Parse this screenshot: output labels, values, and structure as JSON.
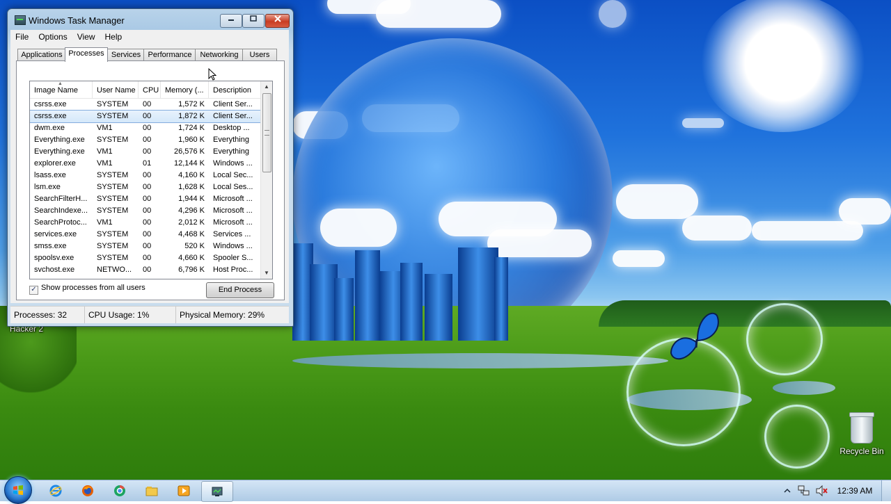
{
  "window": {
    "title": "Windows Task Manager",
    "controls": {
      "minimize": "minimize",
      "maximize": "maximize",
      "close": "close"
    }
  },
  "menu": [
    "File",
    "Options",
    "View",
    "Help"
  ],
  "tabs": [
    "Applications",
    "Processes",
    "Services",
    "Performance",
    "Networking",
    "Users"
  ],
  "active_tab": "Processes",
  "columns": [
    "Image Name",
    "User Name",
    "CPU",
    "Memory (...",
    "Description"
  ],
  "processes": [
    {
      "image": "csrss.exe",
      "user": "SYSTEM",
      "cpu": "00",
      "memory": "1,572 K",
      "desc": "Client Ser..."
    },
    {
      "image": "csrss.exe",
      "user": "SYSTEM",
      "cpu": "00",
      "memory": "1,872 K",
      "desc": "Client Ser..."
    },
    {
      "image": "dwm.exe",
      "user": "VM1",
      "cpu": "00",
      "memory": "1,724 K",
      "desc": "Desktop ..."
    },
    {
      "image": "Everything.exe",
      "user": "SYSTEM",
      "cpu": "00",
      "memory": "1,960 K",
      "desc": "Everything"
    },
    {
      "image": "Everything.exe",
      "user": "VM1",
      "cpu": "00",
      "memory": "26,576 K",
      "desc": "Everything"
    },
    {
      "image": "explorer.exe",
      "user": "VM1",
      "cpu": "01",
      "memory": "12,144 K",
      "desc": "Windows ..."
    },
    {
      "image": "lsass.exe",
      "user": "SYSTEM",
      "cpu": "00",
      "memory": "4,160 K",
      "desc": "Local Sec..."
    },
    {
      "image": "lsm.exe",
      "user": "SYSTEM",
      "cpu": "00",
      "memory": "1,628 K",
      "desc": "Local Ses..."
    },
    {
      "image": "SearchFilterH...",
      "user": "SYSTEM",
      "cpu": "00",
      "memory": "1,944 K",
      "desc": "Microsoft ..."
    },
    {
      "image": "SearchIndexe...",
      "user": "SYSTEM",
      "cpu": "00",
      "memory": "4,296 K",
      "desc": "Microsoft ..."
    },
    {
      "image": "SearchProtoc...",
      "user": "VM1",
      "cpu": "00",
      "memory": "2,012 K",
      "desc": "Microsoft ..."
    },
    {
      "image": "services.exe",
      "user": "SYSTEM",
      "cpu": "00",
      "memory": "4,468 K",
      "desc": "Services ..."
    },
    {
      "image": "smss.exe",
      "user": "SYSTEM",
      "cpu": "00",
      "memory": "520 K",
      "desc": "Windows ..."
    },
    {
      "image": "spoolsv.exe",
      "user": "SYSTEM",
      "cpu": "00",
      "memory": "4,660 K",
      "desc": "Spooler S..."
    },
    {
      "image": "svchost.exe",
      "user": "NETWO...",
      "cpu": "00",
      "memory": "6,796 K",
      "desc": "Host Proc..."
    }
  ],
  "selected_index": 1,
  "show_all_users": {
    "label": "Show processes from all users",
    "checked": true
  },
  "end_process": "End Process",
  "status": {
    "processes": "Processes: 32",
    "cpu": "CPU Usage: 1%",
    "memory": "Physical Memory: 29%"
  },
  "desktop": {
    "icon_label_partial": "Hacker 2",
    "recycle_bin": "Recycle Bin"
  },
  "taskbar": {
    "pinned": [
      "internet-explorer-icon",
      "firefox-icon",
      "chrome-icon",
      "file-explorer-icon",
      "media-player-icon",
      "task-manager-icon"
    ],
    "active": "task-manager-icon",
    "clock": "12:39 AM"
  },
  "colors": {
    "selection": "#d4e8fa",
    "close_button": "#c83c22",
    "taskbar": "#aac8e4"
  }
}
